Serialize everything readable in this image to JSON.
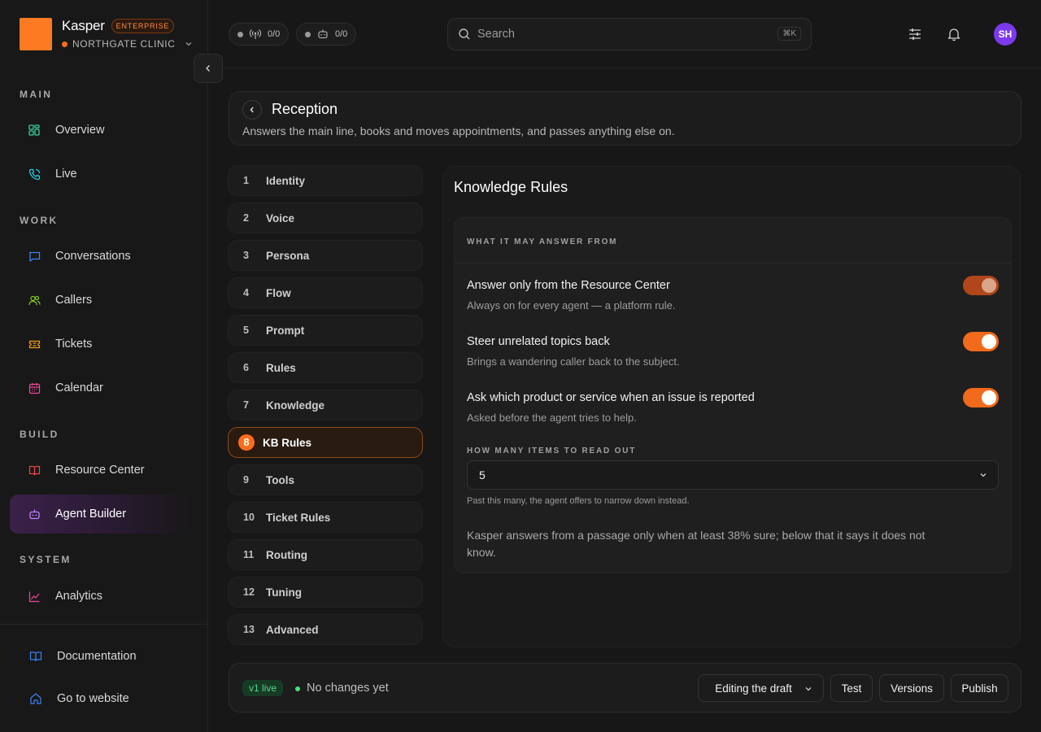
{
  "brand": {
    "name": "Kasper",
    "tier": "ENTERPRISE",
    "org": "NORTHGATE CLINIC",
    "logo_color": "#fb7a22",
    "accent": "#fb6d1c"
  },
  "sidebar": {
    "sections": {
      "main": "MAIN",
      "work": "WORK",
      "build": "BUILD",
      "system": "SYSTEM"
    },
    "items": [
      {
        "label": "Overview",
        "icon": "grid-icon",
        "color": "#34d399"
      },
      {
        "label": "Live",
        "icon": "phone-icon",
        "color": "#22d3ee"
      },
      {
        "label": "Conversations",
        "icon": "chat-icon",
        "color": "#3b82f6"
      },
      {
        "label": "Callers",
        "icon": "users-icon",
        "color": "#84cc16"
      },
      {
        "label": "Tickets",
        "icon": "ticket-icon",
        "color": "#f59e0b"
      },
      {
        "label": "Calendar",
        "icon": "calendar-icon",
        "color": "#ec4899"
      },
      {
        "label": "Resource Center",
        "icon": "book-icon",
        "color": "#ef4444"
      },
      {
        "label": "Agent Builder",
        "icon": "bot-icon",
        "color": "#c084fc",
        "active": true
      },
      {
        "label": "Analytics",
        "icon": "chart-icon",
        "color": "#ec4899"
      }
    ],
    "footer": [
      {
        "label": "Documentation",
        "icon": "book-open-icon"
      },
      {
        "label": "Go to website",
        "icon": "home-icon"
      }
    ]
  },
  "header": {
    "counter_calls": "0/0",
    "counter_bots": "0/0",
    "search_placeholder": "Search",
    "search_shortcut": "⌘K",
    "avatar_initials": "SH"
  },
  "agent": {
    "name": "Reception",
    "description": "Answers the main line, books and moves appointments, and passes anything else on."
  },
  "steps": [
    {
      "num": "1",
      "label": "Identity"
    },
    {
      "num": "2",
      "label": "Voice"
    },
    {
      "num": "3",
      "label": "Persona"
    },
    {
      "num": "4",
      "label": "Flow"
    },
    {
      "num": "5",
      "label": "Prompt"
    },
    {
      "num": "6",
      "label": "Rules"
    },
    {
      "num": "7",
      "label": "Knowledge"
    },
    {
      "num": "8",
      "label": "KB Rules",
      "active": true
    },
    {
      "num": "9",
      "label": "Tools"
    },
    {
      "num": "10",
      "label": "Ticket Rules"
    },
    {
      "num": "11",
      "label": "Routing"
    },
    {
      "num": "12",
      "label": "Tuning"
    },
    {
      "num": "13",
      "label": "Advanced"
    }
  ],
  "panel": {
    "title": "Knowledge Rules",
    "section_answer": "WHAT IT MAY ANSWER FROM",
    "rules": [
      {
        "title": "Answer only from the Resource Center",
        "subtitle": "Always on for every agent — a platform rule.",
        "on": true,
        "locked": true
      },
      {
        "title": "Steer unrelated topics back",
        "subtitle": "Brings a wandering caller back to the subject.",
        "on": true,
        "locked": false
      },
      {
        "title": "Ask which product or service when an issue is reported",
        "subtitle": "Asked before the agent tries to help.",
        "on": true,
        "locked": false
      }
    ],
    "section_items": "HOW MANY ITEMS TO READ OUT",
    "items_value": "5",
    "items_hint": "Past this many, the agent offers to narrow down instead.",
    "note": "Kasper answers from a passage only when at least 38% sure; below that it says it does not know."
  },
  "bottom": {
    "version_badge": "v1 live",
    "status": "No changes yet",
    "mode": "Editing the draft",
    "test": "Test",
    "versions": "Versions",
    "publish": "Publish"
  }
}
